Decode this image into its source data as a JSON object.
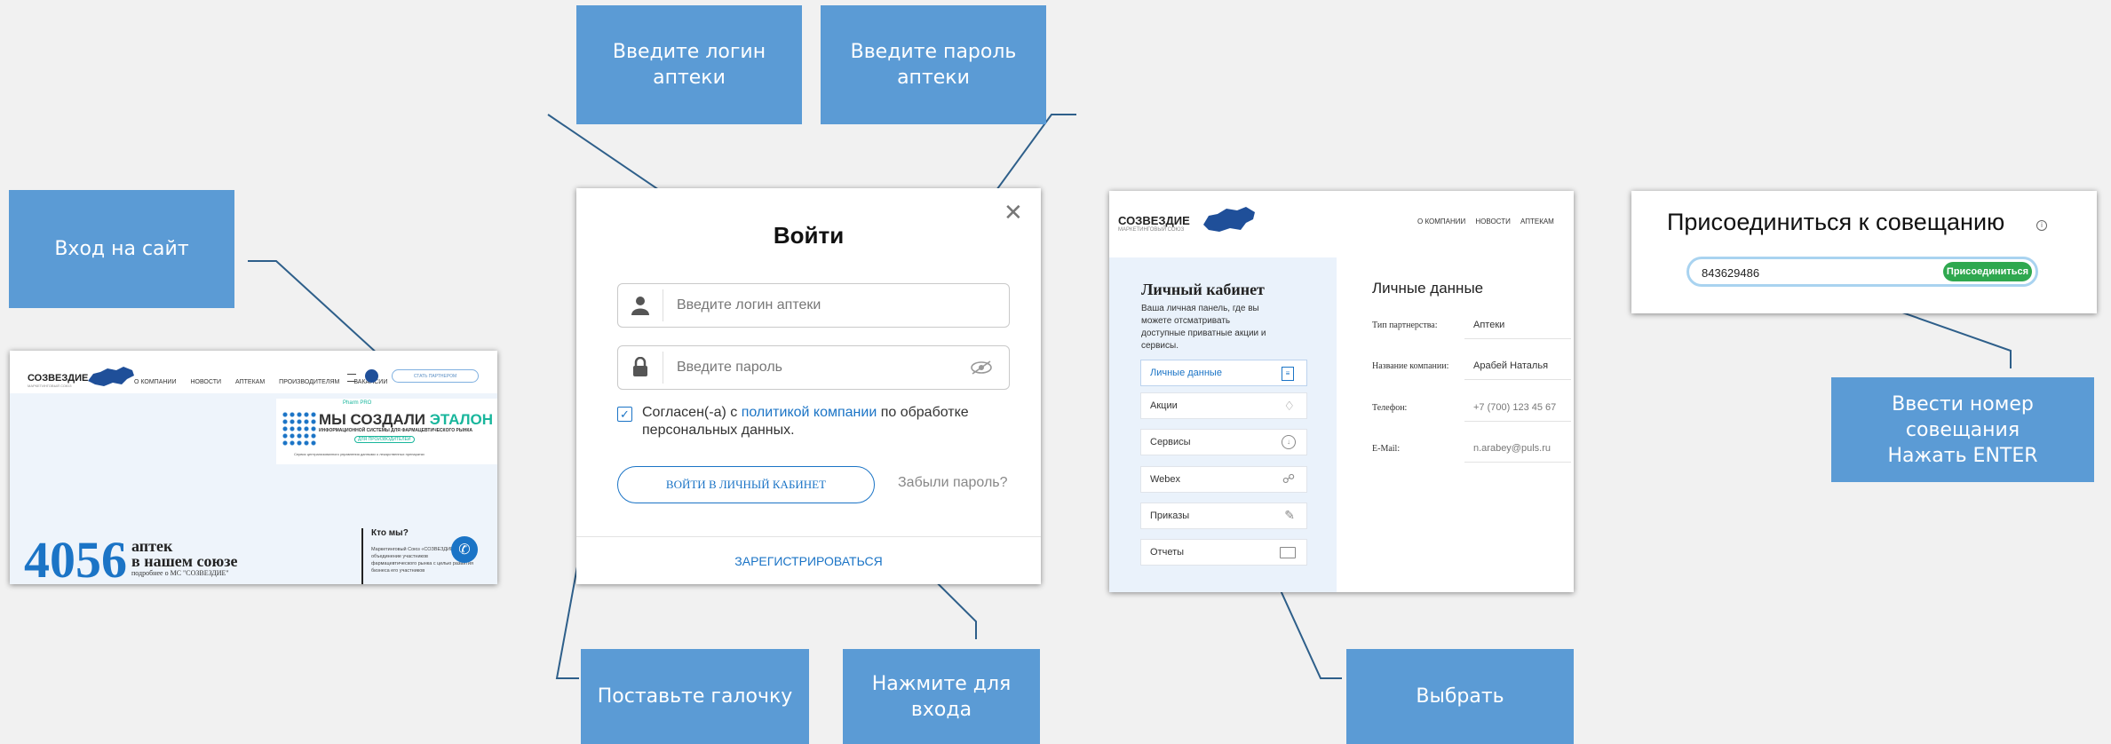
{
  "callouts": {
    "site_login": "Вход на сайт",
    "enter_login": "Введите логин\nаптеки",
    "enter_password": "Введите  пароль\nаптеки",
    "check_box": "Поставьте галочку",
    "press_enter": "Нажмите для\nвхода",
    "choose": "Выбрать",
    "meeting_number": "Ввести номер\nсовещания\nНажать ENTER"
  },
  "site": {
    "logo": "СОЗВЕЗДИЕ",
    "logo_sub": "МАРКЕТИНГОВЫЙ СОЮЗ",
    "nav": [
      "О КОМПАНИИ",
      "НОВОСТИ",
      "АПТЕКАМ",
      "ПРОИЗВОДИТЕЛЯМ",
      "ВАКАНСИИ"
    ],
    "cta": "СТАТЬ ПАРТНЕРОМ",
    "banner_brand": "Pharm PRO",
    "banner_title_a": "МЫ СОЗДАЛИ",
    "banner_title_b": "ЭТАЛОН",
    "banner_sub": "ИНФОРМАЦИОННОЙ СИСТЕМЫ ДЛЯ ФАРМАЦЕВТИЧЕСКОГО РЫНКА",
    "banner_tag": "ДЛЯ ПРОИЗВОДИТЕЛЕЙ",
    "banner_note": "Сервис централизованного управления данными о лекарственных препаратах",
    "big_number": "4056",
    "big_text_1": "аптек",
    "big_text_2": "в нашем союзе",
    "more": "подробнее о МС \"СОЗВЕЗДИЕ\"",
    "who_title": "Кто мы?",
    "who_text": "Маркетинговый Союз «СОЗВЕЗДИЕ» — это объединение участников фармацевтического рынка с целью развития бизнеса его участников"
  },
  "login": {
    "title": "Войти",
    "login_placeholder": "Введите логин аптеки",
    "password_placeholder": "Введите пароль",
    "agree_prefix": "Согласен(-а) с ",
    "agree_link": "политикой компании",
    "agree_suffix": " по обработке персональных данных.",
    "submit": "ВОЙТИ В ЛИЧНЫЙ КАБИНЕТ",
    "forgot": "Забыли пароль?",
    "register": "ЗАРЕГИСТРИРОВАТЬСЯ"
  },
  "cabinet": {
    "logo": "СОЗВЕЗДИЕ",
    "logo_sub": "МАРКЕТИНГОВЫЙ СОЮЗ",
    "nav": [
      "О КОМПАНИИ",
      "НОВОСТИ",
      "АПТЕКАМ"
    ],
    "title": "Личный кабинет",
    "desc": "Ваша личная панель, где вы можете отсматривать доступные приватные акции и сервисы.",
    "menu": [
      "Личные данные",
      "Акции",
      "Сервисы",
      "Webex",
      "Приказы",
      "Отчеты"
    ],
    "section_title": "Личные данные",
    "fields": [
      {
        "label": "Тип партнерства:",
        "value": "Аптеки"
      },
      {
        "label": "Название компании:",
        "value": "Арабей Наталья"
      },
      {
        "label": "Телефон:",
        "value": "+7 (700) 123 45 67"
      },
      {
        "label": "E-Mail:",
        "value": "n.arabey@puls.ru"
      }
    ]
  },
  "meeting": {
    "title": "Присоединиться к совещанию",
    "number": "843629486",
    "join": "Присоединиться"
  },
  "colors": {
    "callout": "#5b9bd5",
    "accent_blue": "#1b74c6",
    "join_green": "#2fa84f",
    "teal": "#19b69c"
  }
}
